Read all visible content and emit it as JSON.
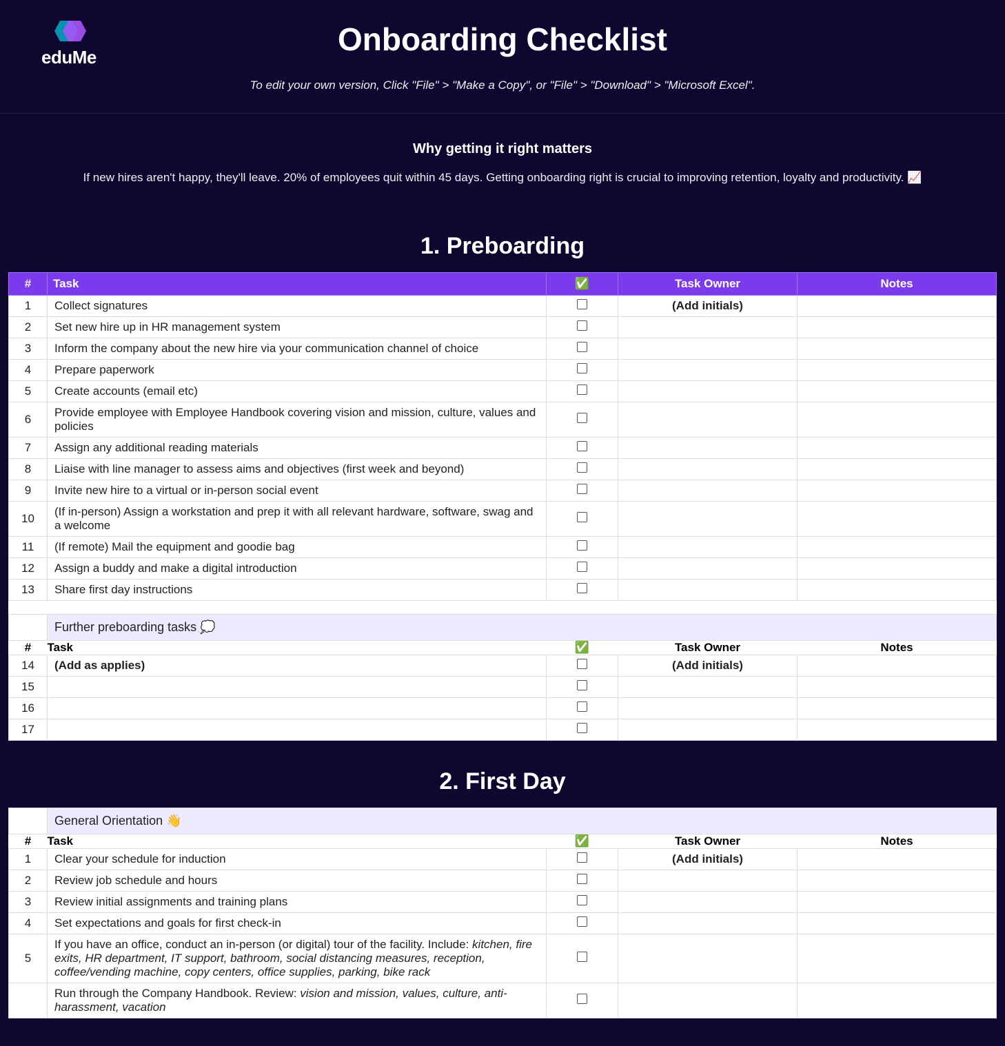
{
  "brand": "eduMe",
  "page_title": "Onboarding Checklist",
  "subtitle": "To edit your own version, Click \"File\" > \"Make a Copy\", or \"File\" > \"Download\" > \"Microsoft Excel\".",
  "intro": {
    "heading": "Why getting it right matters",
    "text": "If new hires aren't happy, they'll leave. 20% of employees quit within 45 days. Getting onboarding right is crucial to improving retention, loyalty and productivity. 📈"
  },
  "columns": {
    "num": "#",
    "task": "Task",
    "check": "✅",
    "owner": "Task Owner",
    "notes": "Notes"
  },
  "owner_placeholder": "(Add initials)",
  "section1": {
    "title": "1. Preboarding",
    "rows": [
      {
        "n": "1",
        "task": "Collect signatures",
        "owner": "(Add initials)"
      },
      {
        "n": "2",
        "task": "Set new hire up in HR management system"
      },
      {
        "n": "3",
        "task": "Inform the company about the new hire via your communication channel of choice"
      },
      {
        "n": "4",
        "task": "Prepare paperwork"
      },
      {
        "n": "5",
        "task": "Create accounts (email etc)"
      },
      {
        "n": "6",
        "task": "Provide employee with Employee Handbook covering vision and mission, culture, values and policies"
      },
      {
        "n": "7",
        "task": "Assign any additional reading materials"
      },
      {
        "n": "8",
        "task": "Liaise with line manager to assess aims and objectives (first week and beyond)"
      },
      {
        "n": "9",
        "task": "Invite new hire to a virtual or in-person social event"
      },
      {
        "n": "10",
        "task": "(If in-person) Assign a workstation and prep it with all relevant hardware, software, swag and a welcome"
      },
      {
        "n": "11",
        "task": "(If remote) Mail the equipment and goodie bag"
      },
      {
        "n": "12",
        "task": "Assign a buddy and make a digital introduction"
      },
      {
        "n": "13",
        "task": "Share first day instructions"
      }
    ],
    "subheader": "Further preboarding tasks 💭",
    "extra_rows": [
      {
        "n": "14",
        "task": "(Add as applies)",
        "bold": true,
        "owner": "(Add initials)"
      },
      {
        "n": "15",
        "task": ""
      },
      {
        "n": "16",
        "task": ""
      },
      {
        "n": "17",
        "task": ""
      }
    ]
  },
  "section2": {
    "title": "2. First Day",
    "subheader": "General Orientation 👋",
    "rows": [
      {
        "n": "1",
        "task": "Clear your schedule for induction",
        "owner": "(Add initials)"
      },
      {
        "n": "2",
        "task": "Review job schedule and hours"
      },
      {
        "n": "3",
        "task": "Review initial assignments and training plans"
      },
      {
        "n": "4",
        "task": "Set expectations and goals for first check-in"
      },
      {
        "n": "5",
        "task_prefix": "If you have an office, conduct an in-person (or digital) tour of the facility. Include: ",
        "task_italic": "kitchen, fire exits, HR department, IT support, bathroom, social distancing measures, reception, coffee/vending machine, copy centers, office supplies, parking, bike rack"
      },
      {
        "n": "",
        "task_prefix": "Run through the Company Handbook. Review: ",
        "task_italic": "vision and mission, values, culture, anti-harassment, vacation"
      }
    ]
  }
}
